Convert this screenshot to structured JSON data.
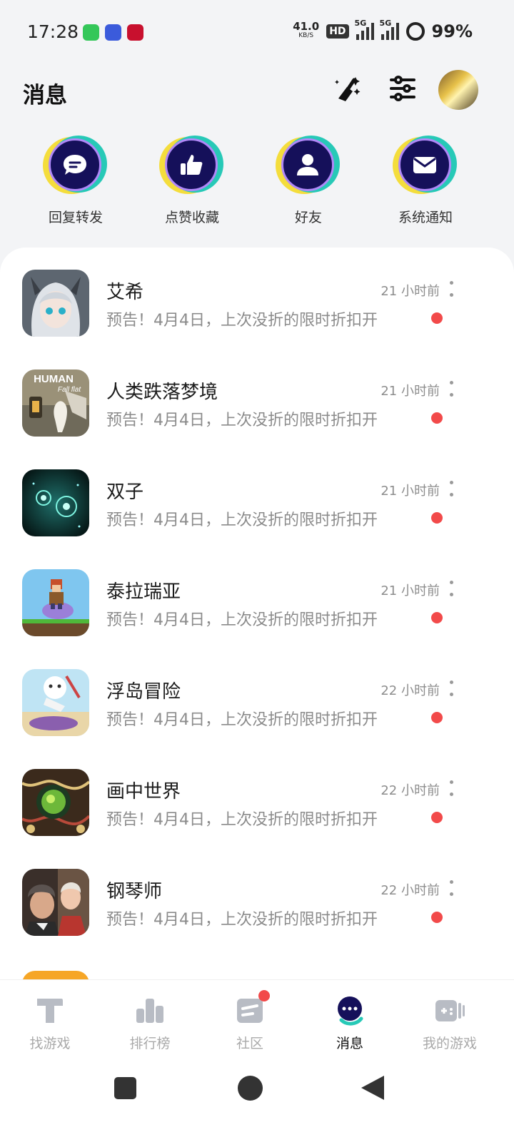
{
  "status_bar": {
    "time": "17:28",
    "net_speed": "41.0",
    "net_unit": "KB/S",
    "hd": "HD",
    "sim1": "5G",
    "sim2": "5G",
    "battery": "99%"
  },
  "header": {
    "title": "消息",
    "icons": [
      "clean-broom-icon",
      "filter-settings-icon",
      "avatar"
    ]
  },
  "quick_actions": [
    {
      "label": "回复转发",
      "icon": "chat-bubble-icon"
    },
    {
      "label": "点赞收藏",
      "icon": "thumbs-up-icon"
    },
    {
      "label": "好友",
      "icon": "person-icon"
    },
    {
      "label": "系统通知",
      "icon": "envelope-icon"
    }
  ],
  "messages": [
    {
      "name": "艾希",
      "time": "21 小时前",
      "preview": "预告！4月4日，上次没折的限时折扣开",
      "unread": true
    },
    {
      "name": "人类跌落梦境",
      "time": "21 小时前",
      "preview": "预告！4月4日，上次没折的限时折扣开",
      "unread": true
    },
    {
      "name": "双子",
      "time": "21 小时前",
      "preview": "预告！4月4日，上次没折的限时折扣开",
      "unread": true
    },
    {
      "name": "泰拉瑞亚",
      "time": "21 小时前",
      "preview": "预告！4月4日，上次没折的限时折扣开",
      "unread": true
    },
    {
      "name": "浮岛冒险",
      "time": "22 小时前",
      "preview": "预告！4月4日，上次没折的限时折扣开",
      "unread": true
    },
    {
      "name": "画中世界",
      "time": "22 小时前",
      "preview": "预告！4月4日，上次没折的限时折扣开",
      "unread": true
    },
    {
      "name": "钢琴师",
      "time": "22 小时前",
      "preview": "预告！4月4日，上次没折的限时折扣开",
      "unread": true
    }
  ],
  "game_icon_text": {
    "human": "HUMAN",
    "fall": "Fall flat"
  },
  "bottom_nav": [
    {
      "label": "找游戏",
      "icon": "find-games-icon",
      "active": false
    },
    {
      "label": "排行榜",
      "icon": "ranking-icon",
      "active": false
    },
    {
      "label": "社区",
      "icon": "community-icon",
      "active": false,
      "badge": true
    },
    {
      "label": "消息",
      "icon": "messages-icon",
      "active": true
    },
    {
      "label": "我的游戏",
      "icon": "my-games-icon",
      "active": false
    }
  ],
  "colors": {
    "accent_teal": "#27c9b7",
    "accent_yellow": "#f4dd3c",
    "core_navy": "#15105a",
    "unread_red": "#f24a4a"
  }
}
